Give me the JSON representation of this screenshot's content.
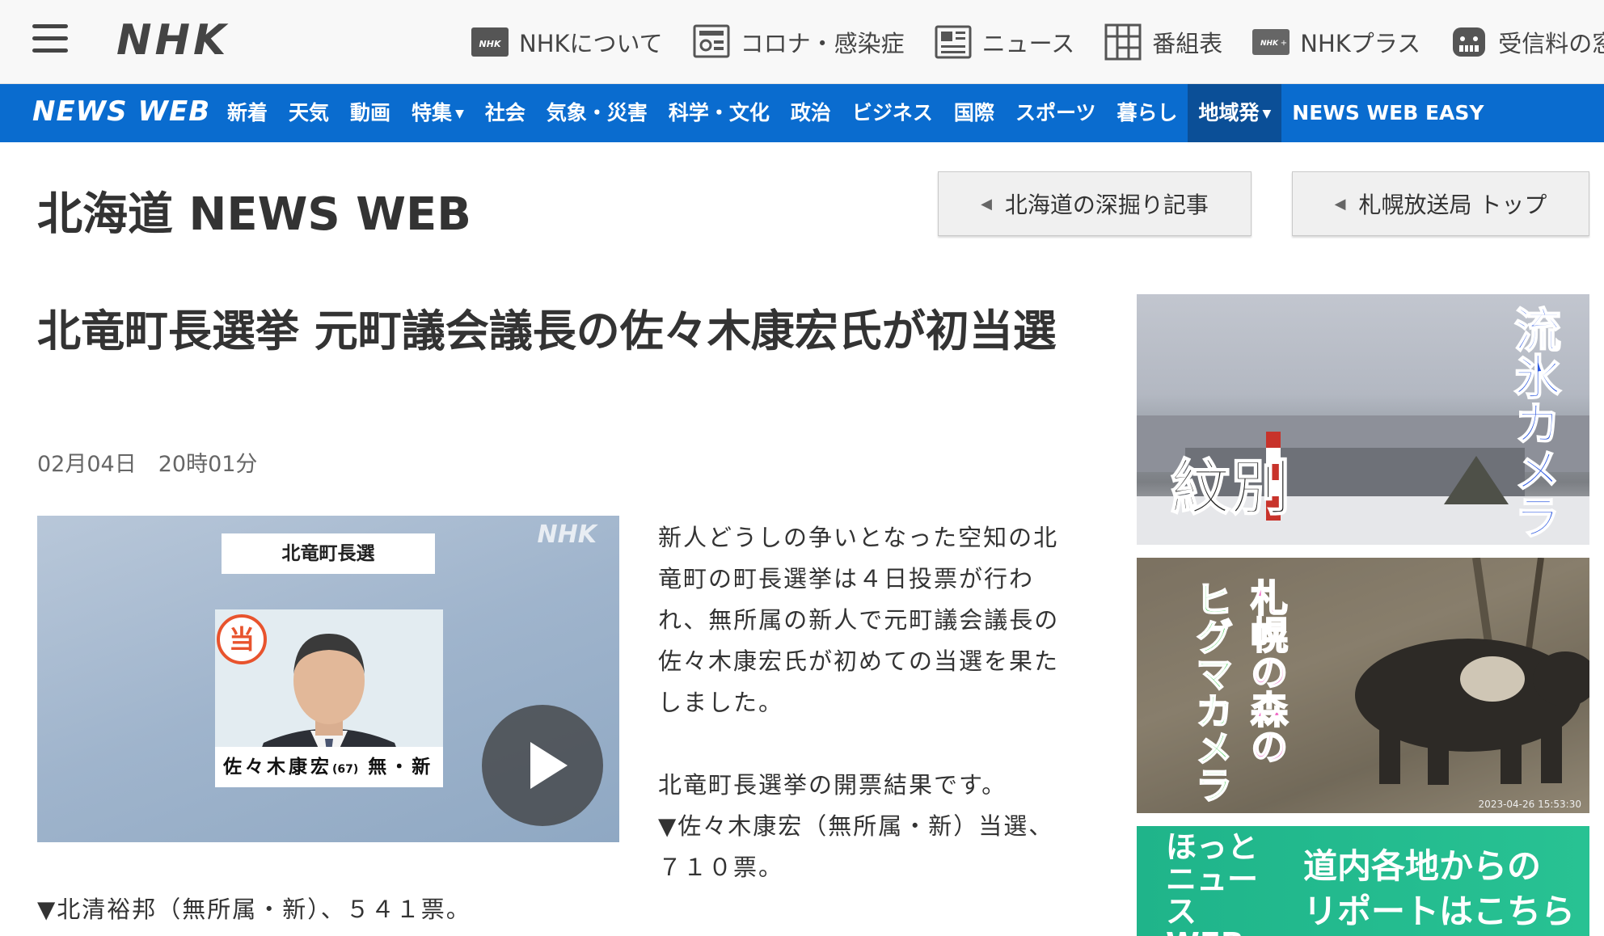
{
  "header": {
    "logo": "NHK",
    "links": [
      {
        "label": "NHKについて",
        "icon": "nhk-box-icon"
      },
      {
        "label": "コロナ・感染症",
        "icon": "corona-icon"
      },
      {
        "label": "ニュース",
        "icon": "news-icon"
      },
      {
        "label": "番組表",
        "icon": "grid-icon"
      },
      {
        "label": "NHKプラス",
        "icon": "nhkplus-icon"
      },
      {
        "label": "受信料の窓口",
        "icon": "domo-icon"
      }
    ]
  },
  "nav": {
    "logo": "NEWS WEB",
    "items": [
      "新着",
      "天気",
      "動画",
      "特集",
      "社会",
      "気象・災害",
      "科学・文化",
      "政治",
      "ビジネス",
      "国際",
      "スポーツ",
      "暮らし",
      "地域発",
      "NEWS WEB EASY"
    ],
    "active": "地域発",
    "accent": "#0a6ccf"
  },
  "section": {
    "title": "北海道 NEWS WEB",
    "buttons": [
      "北海道の深掘り記事",
      "札幌放送局 トップ"
    ]
  },
  "article": {
    "headline": "北竜町長選挙 元町議会議長の佐々木康宏氏が初当選",
    "date": "02月04日　20時01分",
    "video": {
      "watermark": "NHK",
      "caption": "北竜町長選",
      "badge": "当",
      "name": "佐々木康宏",
      "age": "(67)",
      "party": "無・新"
    },
    "paragraphs": [
      "新人どうしの争いとなった空知の北竜町の町長選挙は４日投票が行われ、無所属の新人で元町議会議長の佐々木康宏氏が初めての当選を果たしました。",
      "北竜町長選挙の開票結果です。",
      "▼佐々木康宏（無所属・新）当選、７１０票。"
    ],
    "bottom_line": "▼北清裕邦（無所属・新）、５４１票。"
  },
  "sidebar": {
    "banner1": {
      "title": "流氷カメラ",
      "place": "紋別"
    },
    "banner2": {
      "line1": "札幌の森の",
      "line2": "ヒグマカメラ",
      "stamp": "2023-04-26 15:53:30"
    },
    "banner3": {
      "left": "ほっとニュースWEB",
      "right1": "道内各地からの",
      "right2": "リポートはこちら"
    }
  }
}
